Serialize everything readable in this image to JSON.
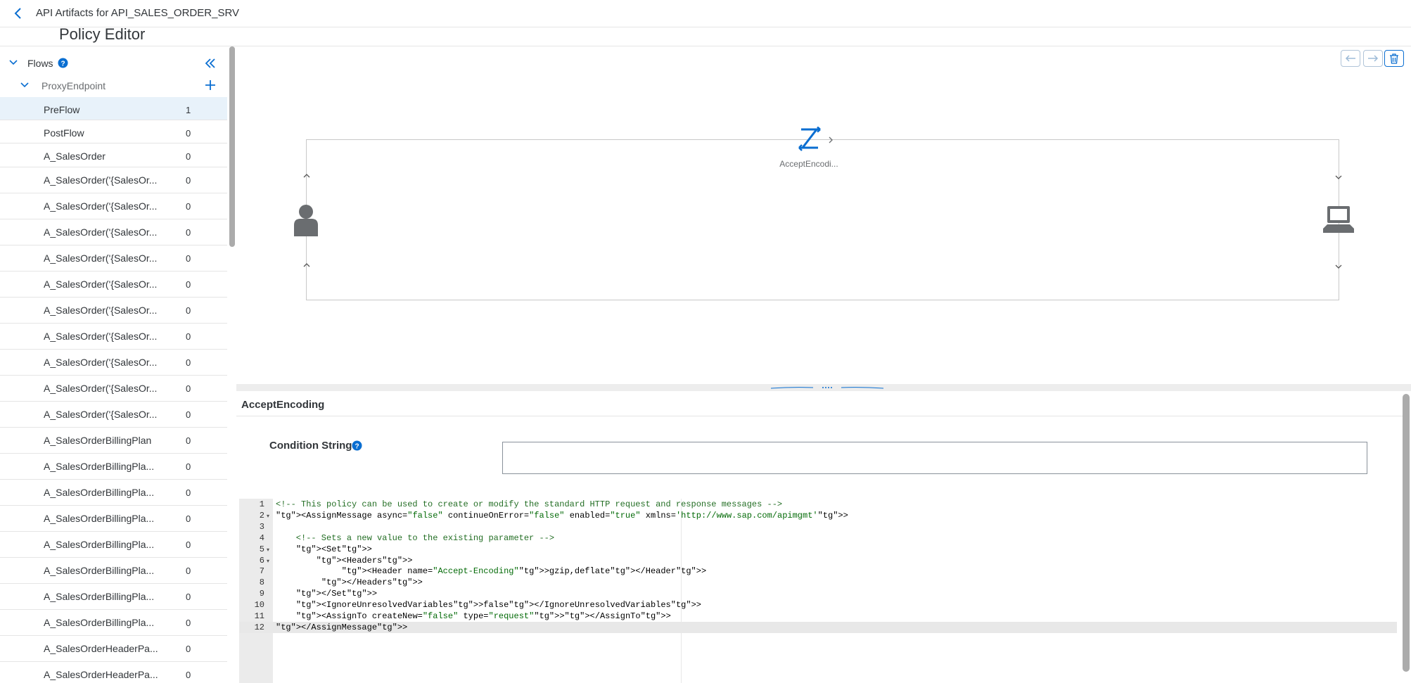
{
  "header": {
    "breadcrumb": "API Artifacts for API_SALES_ORDER_SRV",
    "title": "Policy Editor"
  },
  "tree": {
    "flows_label": "Flows",
    "proxy_label": "ProxyEndpoint"
  },
  "flows": [
    {
      "name": "PreFlow",
      "count": "1",
      "selected": true
    },
    {
      "name": "PostFlow",
      "count": "0"
    },
    {
      "name": "A_SalesOrder",
      "count": "0"
    },
    {
      "name": "A_SalesOrder('{SalesOr...",
      "count": "0"
    },
    {
      "name": "A_SalesOrder('{SalesOr...",
      "count": "0"
    },
    {
      "name": "A_SalesOrder('{SalesOr...",
      "count": "0"
    },
    {
      "name": "A_SalesOrder('{SalesOr...",
      "count": "0"
    },
    {
      "name": "A_SalesOrder('{SalesOr...",
      "count": "0"
    },
    {
      "name": "A_SalesOrder('{SalesOr...",
      "count": "0"
    },
    {
      "name": "A_SalesOrder('{SalesOr...",
      "count": "0"
    },
    {
      "name": "A_SalesOrder('{SalesOr...",
      "count": "0"
    },
    {
      "name": "A_SalesOrder('{SalesOr...",
      "count": "0"
    },
    {
      "name": "A_SalesOrder('{SalesOr...",
      "count": "0"
    },
    {
      "name": "A_SalesOrderBillingPlan",
      "count": "0"
    },
    {
      "name": "A_SalesOrderBillingPla...",
      "count": "0"
    },
    {
      "name": "A_SalesOrderBillingPla...",
      "count": "0"
    },
    {
      "name": "A_SalesOrderBillingPla...",
      "count": "0"
    },
    {
      "name": "A_SalesOrderBillingPla...",
      "count": "0"
    },
    {
      "name": "A_SalesOrderBillingPla...",
      "count": "0"
    },
    {
      "name": "A_SalesOrderBillingPla...",
      "count": "0"
    },
    {
      "name": "A_SalesOrderBillingPla...",
      "count": "0"
    },
    {
      "name": "A_SalesOrderHeaderPa...",
      "count": "0"
    },
    {
      "name": "A_SalesOrderHeaderPa...",
      "count": "0"
    }
  ],
  "canvas": {
    "policy_label": "AcceptEncodi..."
  },
  "details": {
    "section_title": "AcceptEncoding",
    "condition_label": "Condition String",
    "condition_value": ""
  },
  "editor": {
    "lines": [
      "<!-- This policy can be used to create or modify the standard HTTP request and response messages -->",
      "<AssignMessage async=\"false\" continueOnError=\"false\" enabled=\"true\" xmlns='http://www.sap.com/apimgmt'>",
      "",
      "    <!-- Sets a new value to the existing parameter -->",
      "    <Set>",
      "        <Headers>",
      "             <Header name=\"Accept-Encoding\">gzip,deflate</Header>",
      "         </Headers>",
      "    </Set>",
      "    <IgnoreUnresolvedVariables>false</IgnoreUnresolvedVariables>",
      "    <AssignTo createNew=\"false\" type=\"request\"></AssignTo>",
      "</AssignMessage>"
    ]
  },
  "colors": {
    "accent": "#0a6ed1",
    "selected_row": "#e8f2fa",
    "icon_gray": "#6a6d70"
  }
}
